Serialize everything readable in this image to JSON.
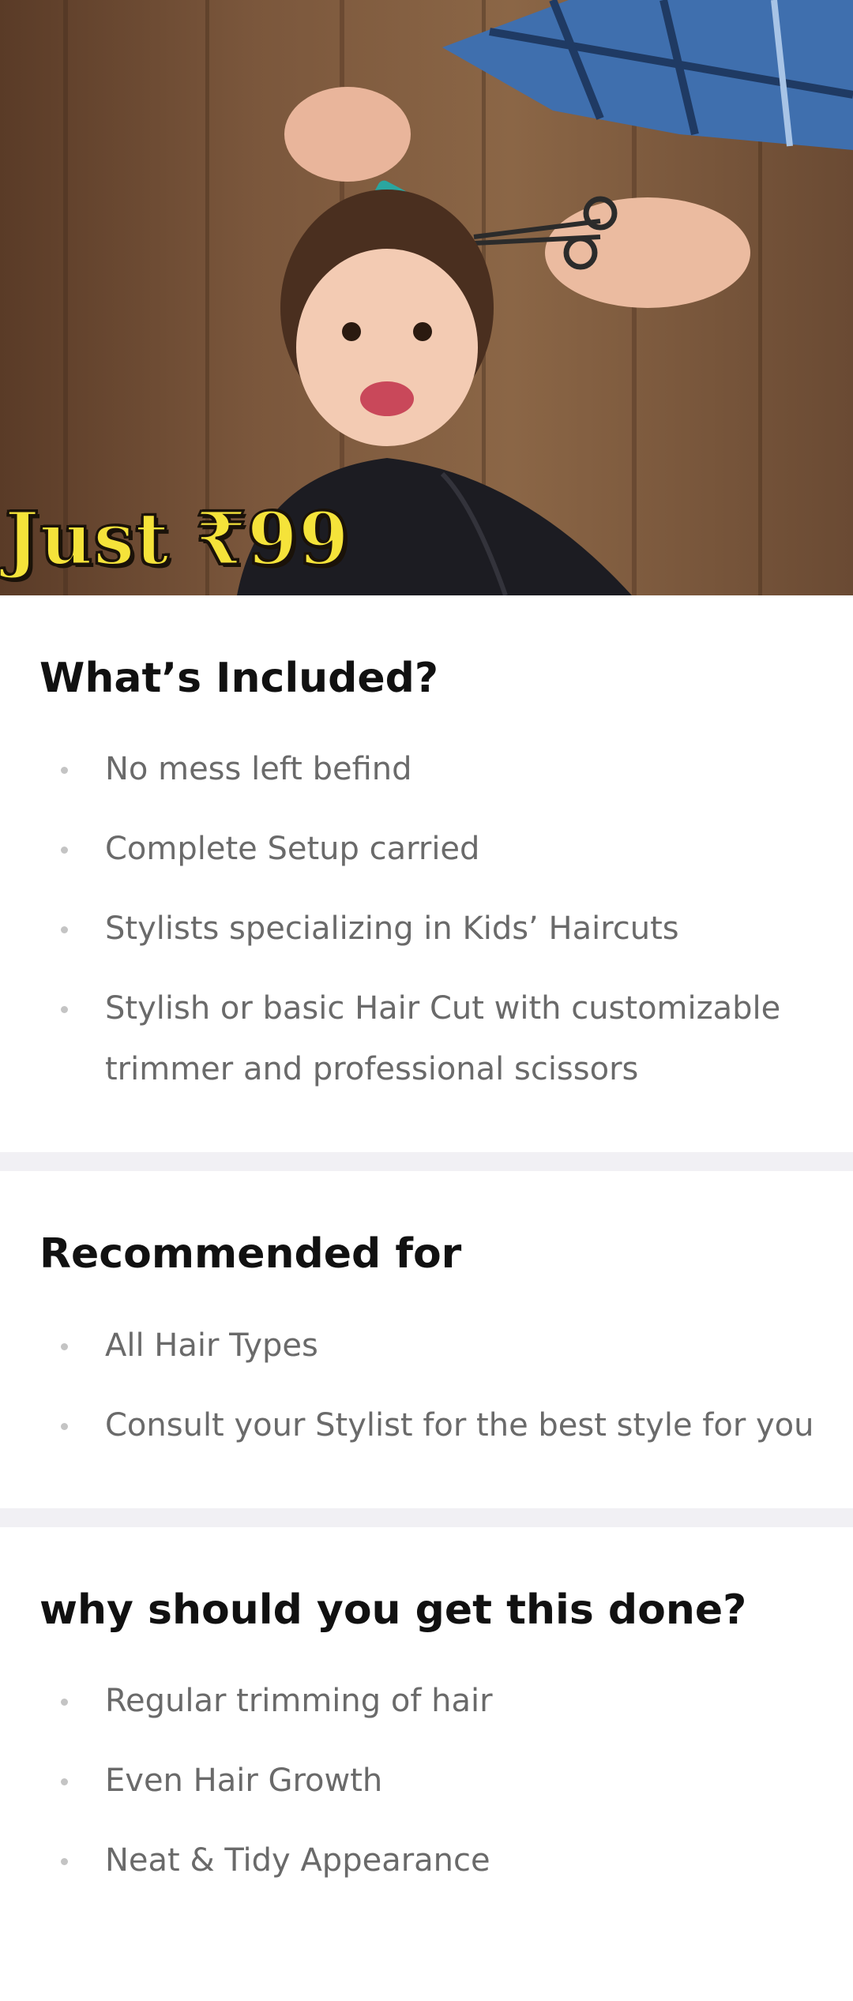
{
  "hero": {
    "image_description_icon": "kids-haircut-photo",
    "promo_text": "Just ₹99"
  },
  "sections": [
    {
      "title": "What’s Included?",
      "items": [
        "No mess left befind",
        "Complete Setup carried",
        "Stylists specializing in Kids’ Haircuts",
        "Stylish or basic Hair Cut with customizable trimmer and professional scissors"
      ]
    },
    {
      "title": "Recommended for",
      "items": [
        "All Hair Types",
        "Consult your Stylist for the best style for you"
      ]
    },
    {
      "title": "why should you get this done?",
      "items": [
        "Regular trimming of hair",
        "Even Hair Growth",
        "Neat & Tidy Appearance"
      ]
    }
  ],
  "colors": {
    "promo_fill": "#f5e33a",
    "divider": "#f1f0f4",
    "title": "#111111",
    "body_text": "#6a6a6a",
    "bullet": "#c4c4c4"
  }
}
